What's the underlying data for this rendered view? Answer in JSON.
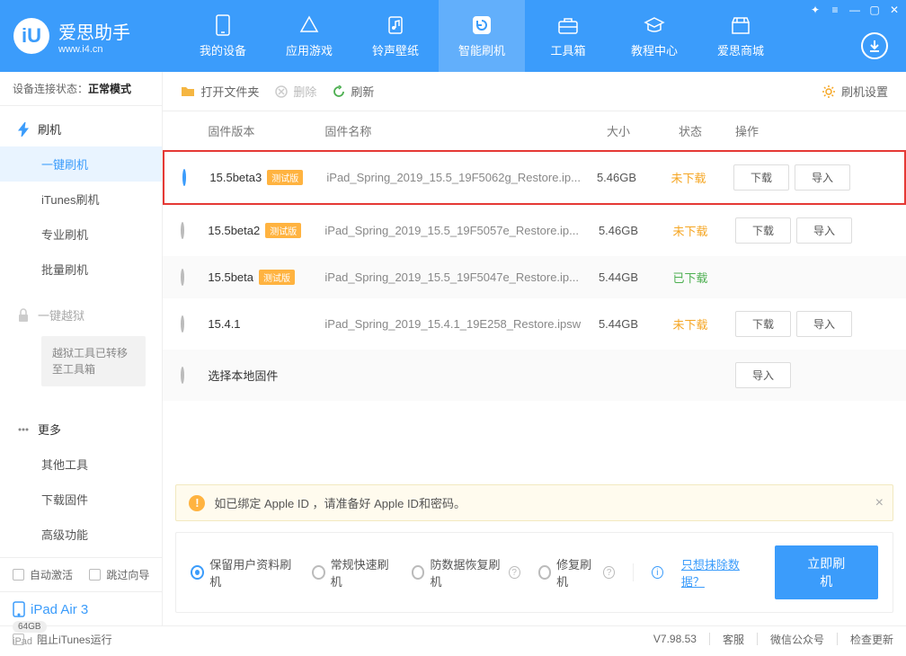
{
  "brand": {
    "logo": "iU",
    "name_cn": "爱思助手",
    "url": "www.i4.cn"
  },
  "topnav": [
    {
      "label": "我的设备"
    },
    {
      "label": "应用游戏"
    },
    {
      "label": "铃声壁纸"
    },
    {
      "label": "智能刷机"
    },
    {
      "label": "工具箱"
    },
    {
      "label": "教程中心"
    },
    {
      "label": "爱思商城"
    }
  ],
  "topnav_active": 3,
  "conn_status": {
    "label": "设备连接状态：",
    "value": "正常模式"
  },
  "side": {
    "flash_header": "刷机",
    "flash_items": [
      "一键刷机",
      "iTunes刷机",
      "专业刷机",
      "批量刷机"
    ],
    "jailbreak_header": "一键越狱",
    "jailbreak_note": "越狱工具已转移至工具箱",
    "more_header": "更多",
    "more_items": [
      "其他工具",
      "下载固件",
      "高级功能"
    ]
  },
  "checkboxes": {
    "auto_activate": "自动激活",
    "skip_guide": "跳过向导"
  },
  "device": {
    "name": "iPad Air 3",
    "capacity": "64GB",
    "type": "iPad"
  },
  "toolbar": {
    "open_folder": "打开文件夹",
    "delete": "删除",
    "refresh": "刷新",
    "settings": "刷机设置"
  },
  "columns": {
    "version": "固件版本",
    "name": "固件名称",
    "size": "大小",
    "status": "状态",
    "actions": "操作"
  },
  "rows": [
    {
      "version": "15.5beta3",
      "tag": "测试版",
      "name": "iPad_Spring_2019_15.5_19F5062g_Restore.ip...",
      "size": "5.46GB",
      "status_key": "not",
      "status": "未下载",
      "selected": true,
      "highlight": true,
      "alt": false,
      "dl": true,
      "imp": true
    },
    {
      "version": "15.5beta2",
      "tag": "测试版",
      "name": "iPad_Spring_2019_15.5_19F5057e_Restore.ip...",
      "size": "5.46GB",
      "status_key": "not",
      "status": "未下载",
      "selected": false,
      "highlight": false,
      "alt": false,
      "dl": true,
      "imp": true
    },
    {
      "version": "15.5beta",
      "tag": "测试版",
      "name": "iPad_Spring_2019_15.5_19F5047e_Restore.ip...",
      "size": "5.44GB",
      "status_key": "done",
      "status": "已下载",
      "selected": false,
      "highlight": false,
      "alt": true,
      "dl": false,
      "imp": false
    },
    {
      "version": "15.4.1",
      "tag": "",
      "name": "iPad_Spring_2019_15.4.1_19E258_Restore.ipsw",
      "size": "5.44GB",
      "status_key": "not",
      "status": "未下载",
      "selected": false,
      "highlight": false,
      "alt": false,
      "dl": true,
      "imp": true
    },
    {
      "version": "",
      "tag": "",
      "name": "选择本地固件",
      "size": "",
      "status_key": "",
      "status": "",
      "selected": false,
      "highlight": false,
      "alt": true,
      "dl": false,
      "imp": true,
      "local": true
    }
  ],
  "buttons": {
    "download": "下载",
    "import": "导入"
  },
  "notice": "如已绑定 Apple ID ，请准备好 Apple ID和密码。",
  "flash_options": [
    {
      "label": "保留用户资料刷机",
      "selected": true,
      "help": false
    },
    {
      "label": "常规快速刷机",
      "selected": false,
      "help": false
    },
    {
      "label": "防数据恢复刷机",
      "selected": false,
      "help": true
    },
    {
      "label": "修复刷机",
      "selected": false,
      "help": true
    }
  ],
  "erase_link": "只想抹除数据？",
  "flash_now": "立即刷机",
  "footer": {
    "block_itunes": "阻止iTunes运行",
    "version": "V7.98.53",
    "support": "客服",
    "wechat": "微信公众号",
    "update": "检查更新"
  }
}
